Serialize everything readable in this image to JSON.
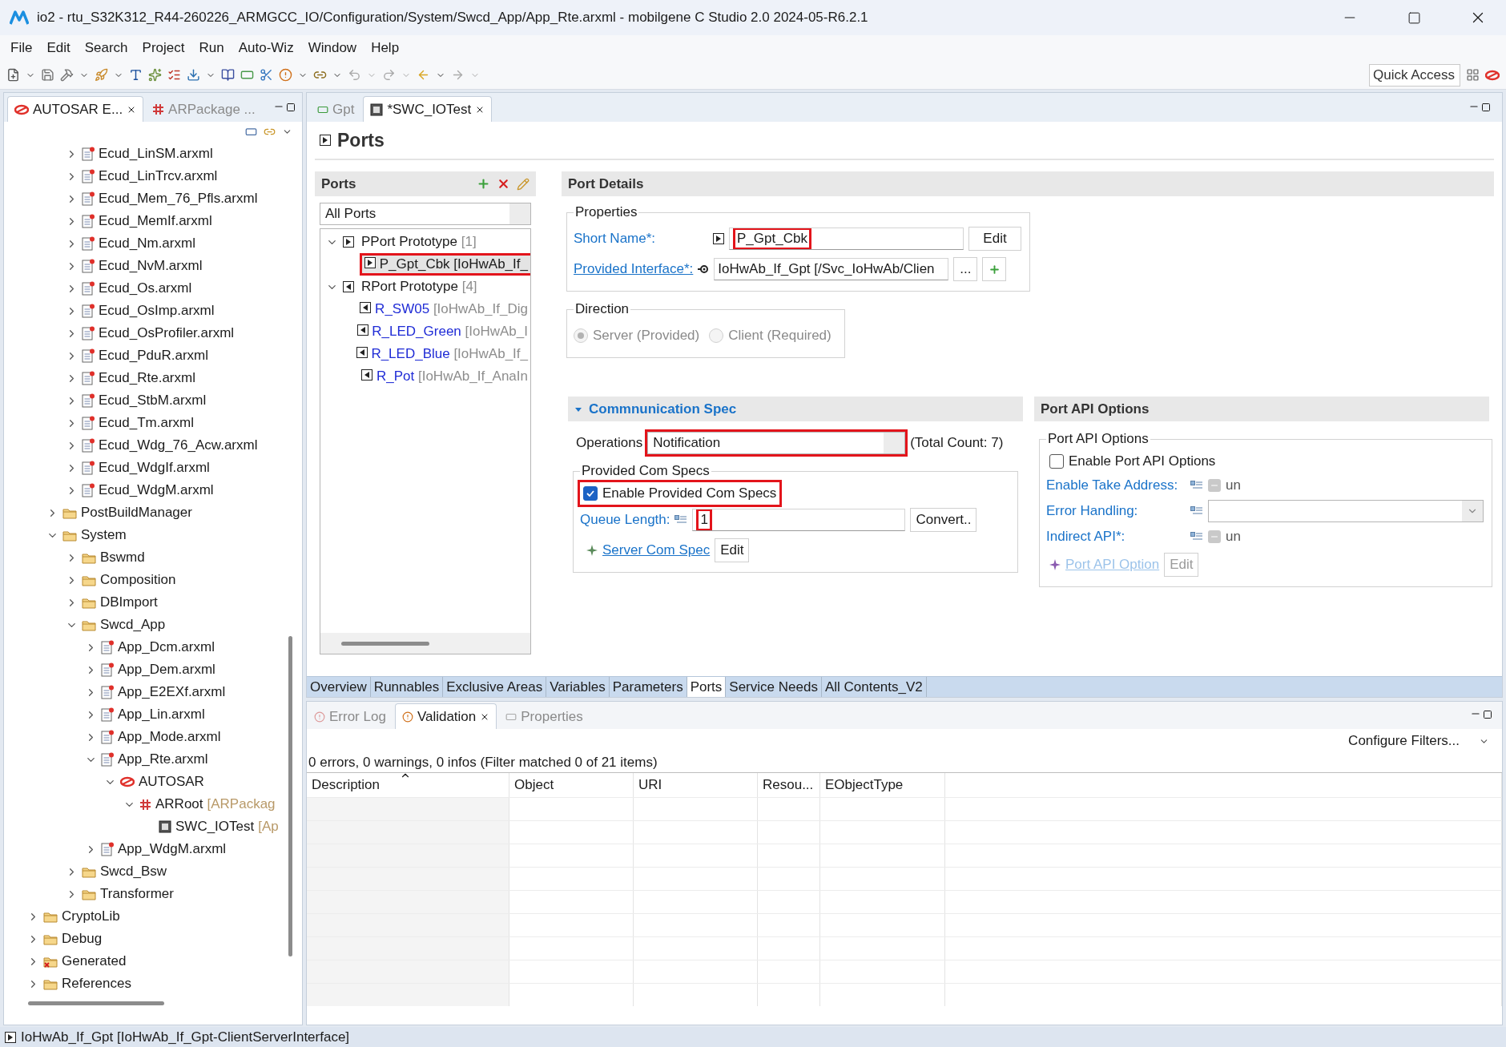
{
  "window": {
    "title": "io2 - rtu_S32K312_R44-260226_ARMGCC_IO/Configuration/System/Swcd_App/App_Rte.arxml - mobilgene C Studio 2.0 2024-05-R6.2.1"
  },
  "menu": [
    "File",
    "Edit",
    "Search",
    "Project",
    "Run",
    "Auto-Wiz",
    "Window",
    "Help"
  ],
  "toolbar": {
    "quick_access": {
      "placeholder": "Quick Access"
    }
  },
  "explorer": {
    "tabs": [
      {
        "label": "AUTOSAR E...",
        "selected": true
      },
      {
        "label": "ARPackage ...",
        "selected": false
      }
    ],
    "tree": [
      {
        "children": [
          {
            "children": [
              {
                "label": "Ecud_LinSM.arxml",
                "kind": "file",
                "expanded": false
              },
              {
                "label": "Ecud_LinTrcv.arxml",
                "kind": "file",
                "expanded": false
              },
              {
                "label": "Ecud_Mem_76_Pfls.arxml",
                "kind": "file",
                "expanded": false
              },
              {
                "label": "Ecud_MemIf.arxml",
                "kind": "file",
                "expanded": false
              },
              {
                "label": "Ecud_Nm.arxml",
                "kind": "file",
                "expanded": false
              },
              {
                "label": "Ecud_NvM.arxml",
                "kind": "file",
                "expanded": false
              },
              {
                "label": "Ecud_Os.arxml",
                "kind": "file",
                "expanded": false
              },
              {
                "label": "Ecud_OsImp.arxml",
                "kind": "file",
                "expanded": false
              },
              {
                "label": "Ecud_OsProfiler.arxml",
                "kind": "file",
                "expanded": false
              },
              {
                "label": "Ecud_PduR.arxml",
                "kind": "file",
                "expanded": false
              },
              {
                "label": "Ecud_Rte.arxml",
                "kind": "file",
                "expanded": false
              },
              {
                "label": "Ecud_StbM.arxml",
                "kind": "file",
                "expanded": false
              },
              {
                "label": "Ecud_Tm.arxml",
                "kind": "file",
                "expanded": false
              },
              {
                "label": "Ecud_Wdg_76_Acw.arxml",
                "kind": "file",
                "expanded": false
              },
              {
                "label": "Ecud_WdgIf.arxml",
                "kind": "file",
                "expanded": false
              },
              {
                "label": "Ecud_WdgM.arxml",
                "kind": "file",
                "expanded": false
              }
            ]
          },
          {
            "label": "PostBuildManager",
            "kind": "folder",
            "expanded": false
          },
          {
            "label": "System",
            "kind": "folder",
            "expanded": true,
            "children": [
              {
                "label": "Bswmd",
                "kind": "folder",
                "expanded": false
              },
              {
                "label": "Composition",
                "kind": "folder",
                "expanded": false
              },
              {
                "label": "DBImport",
                "kind": "folder",
                "expanded": false
              },
              {
                "label": "Swcd_App",
                "kind": "folder",
                "expanded": true,
                "children": [
                  {
                    "label": "App_Dcm.arxml",
                    "kind": "file",
                    "expanded": false
                  },
                  {
                    "label": "App_Dem.arxml",
                    "kind": "file",
                    "expanded": false
                  },
                  {
                    "label": "App_E2EXf.arxml",
                    "kind": "file",
                    "expanded": false
                  },
                  {
                    "label": "App_Lin.arxml",
                    "kind": "file",
                    "expanded": false
                  },
                  {
                    "label": "App_Mode.arxml",
                    "kind": "file",
                    "expanded": false
                  },
                  {
                    "label": "App_Rte.arxml",
                    "kind": "file",
                    "expanded": true,
                    "children": [
                      {
                        "label": "AUTOSAR",
                        "kind": "autosar",
                        "expanded": true,
                        "children": [
                          {
                            "label": "ARRoot",
                            "suffix": "[ARPackag",
                            "kind": "package",
                            "expanded": true,
                            "children": [
                              {
                                "label": "SWC_IOTest",
                                "suffix": "[Ap",
                                "kind": "component"
                              }
                            ]
                          }
                        ]
                      }
                    ]
                  },
                  {
                    "label": "App_WdgM.arxml",
                    "kind": "file",
                    "expanded": false
                  }
                ]
              },
              {
                "label": "Swcd_Bsw",
                "kind": "folder",
                "expanded": false
              },
              {
                "label": "Transformer",
                "kind": "folder",
                "expanded": false
              }
            ]
          }
        ]
      },
      {
        "label": "CryptoLib",
        "kind": "folder",
        "expanded": false
      },
      {
        "label": "Debug",
        "kind": "folder",
        "expanded": false
      },
      {
        "label": "Generated",
        "kind": "generated",
        "expanded": false
      },
      {
        "label": "References",
        "kind": "folder",
        "expanded": false
      }
    ]
  },
  "editor": {
    "tabs": [
      {
        "label": "Gpt",
        "selected": false
      },
      {
        "label": "*SWC_IOTest",
        "selected": true
      }
    ],
    "heading": "Ports",
    "ports": {
      "title": "Ports",
      "filter": "All Ports",
      "tree": [
        {
          "label": "PPort Prototype",
          "count": "[1]",
          "kind": "pport",
          "expanded": true,
          "selected": false,
          "children": [
            {
              "label": "P_Gpt_Cbk",
              "suffix": "[IoHwAb_If_",
              "kind": "pport",
              "selected": true,
              "highlighted": true
            }
          ]
        },
        {
          "label": "RPort Prototype",
          "count": "[4]",
          "kind": "rport",
          "expanded": true,
          "selected": false,
          "children": [
            {
              "label": "R_SW05",
              "suffix": "[IoHwAb_If_Dig",
              "kind": "rport",
              "selected": false,
              "highlighted": false
            },
            {
              "label": "R_LED_Green",
              "suffix": "[IoHwAb_I",
              "kind": "rport",
              "selected": false,
              "highlighted": false
            },
            {
              "label": "R_LED_Blue",
              "suffix": "[IoHwAb_If_",
              "kind": "rport",
              "selected": false,
              "highlighted": false
            },
            {
              "label": "R_Pot",
              "suffix": "[IoHwAb_If_AnaIn",
              "kind": "rport",
              "selected": false,
              "highlighted": false
            }
          ]
        }
      ]
    },
    "details": {
      "title": "Port Details",
      "properties": {
        "title": "Properties",
        "short_name": {
          "label": "Short Name*:",
          "value": "P_Gpt_Cbk",
          "highlighted": true,
          "button": "Edit"
        },
        "interface": {
          "label": "Provided Interface*:",
          "value": "IoHwAb_If_Gpt [/Svc_IoHwAb/Clien",
          "button": "..."
        }
      },
      "direction": {
        "title": "Direction",
        "disabled": true,
        "options": [
          {
            "label": "Server (Provided)",
            "selected": true
          },
          {
            "label": "Client (Required)",
            "selected": false
          }
        ]
      },
      "com_spec": {
        "title": "Commnunication Spec",
        "expanded": true,
        "operations_label": "Operations",
        "operations": "Notification",
        "operations_highlighted": true,
        "total": "(Total Count: 7)",
        "group": {
          "title": "Provided Com Specs",
          "enable": {
            "label": "Enable Provided Com Specs",
            "checked": true,
            "highlighted": true
          },
          "queue": {
            "label": "Queue Length:",
            "value": "1",
            "highlighted": true,
            "button": "Convert.."
          },
          "link": "Server Com Spec",
          "link_button": "Edit"
        }
      },
      "api": {
        "title": "Port API Options",
        "group_title": "Port API Options",
        "enable": {
          "label": "Enable Port API Options",
          "checked": false
        },
        "disabled": true,
        "rows": [
          {
            "kind": "toggle",
            "label": "Enable Take Address:",
            "value": "un",
            "checked": false
          },
          {
            "kind": "combo",
            "label": "Error Handling:"
          },
          {
            "kind": "toggle",
            "label": "Indirect API*:",
            "value": "un",
            "checked": false
          }
        ],
        "link": "Port API Option",
        "link_button": "Edit"
      }
    },
    "page_tabs": [
      {
        "label": "Overview",
        "selected": false
      },
      {
        "label": "Runnables",
        "selected": false
      },
      {
        "label": "Exclusive Areas",
        "selected": false
      },
      {
        "label": "Variables",
        "selected": false
      },
      {
        "label": "Parameters",
        "selected": false
      },
      {
        "label": "Ports",
        "selected": true
      },
      {
        "label": "Service Needs",
        "selected": false
      },
      {
        "label": "All Contents_V2",
        "selected": false
      }
    ]
  },
  "validation": {
    "tabs": [
      {
        "label": "Error Log",
        "selected": false
      },
      {
        "label": "Validation",
        "selected": true
      },
      {
        "label": "Properties",
        "selected": false
      }
    ],
    "configure": "Configure Filters...",
    "summary": "0 errors, 0 warnings, 0 infos (Filter matched 0 of 21 items)",
    "columns": [
      {
        "label": "Description",
        "sorted": true
      },
      {
        "label": "Object",
        "sorted": false
      },
      {
        "label": "URI",
        "sorted": false
      },
      {
        "label": "Resou...",
        "sorted": false
      },
      {
        "label": "EObjectType",
        "sorted": false
      }
    ]
  },
  "status_bar": "IoHwAb_If_Gpt [IoHwAb_If_Gpt-ClientServerInterface]"
}
